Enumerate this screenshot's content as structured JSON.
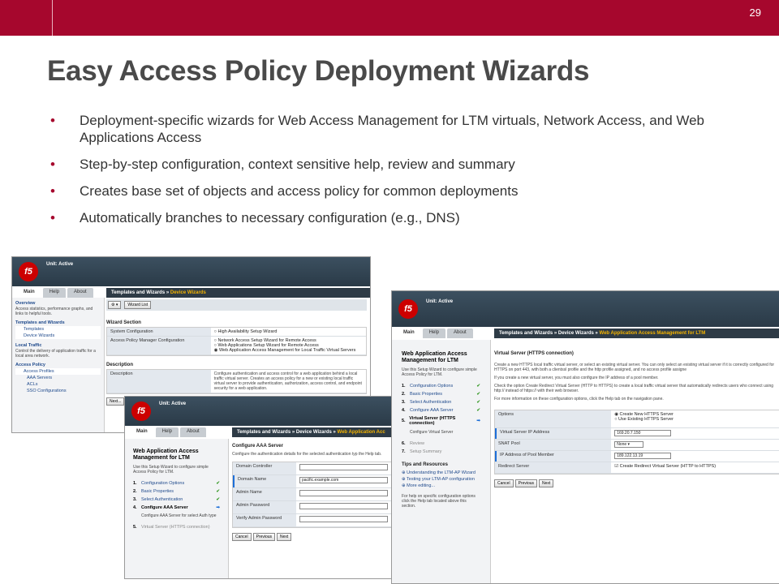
{
  "slide": {
    "page_number": "29",
    "title": "Easy Access Policy Deployment Wizards"
  },
  "bullets": [
    "Deployment-specific wizards for Web Access Management for LTM virtuals, Network Access, and Web Applications Access",
    "Step-by-step configuration, context sensitive help, review and summary",
    "Creates base set of objects and access policy for common deployments",
    "Automatically branches to necessary configuration (e.g., DNS)"
  ],
  "common": {
    "logo": "f5",
    "unit": "Unit: Active",
    "tab_main": "Main",
    "tab_help": "Help",
    "tab_about": "About"
  },
  "shot1": {
    "crumb_a": "Templates and Wizards »",
    "crumb_b": "Device Wizards",
    "toolbar_btn": "Wizard List",
    "nav": [
      {
        "title": "Overview",
        "desc": "Access statistics, performance graphs, and links to helpful tools."
      },
      {
        "title": "Templates and Wizards",
        "sub": [
          "Templates",
          "Device Wizards"
        ]
      },
      {
        "title": "Local Traffic",
        "desc": "Control the delivery of application traffic for a local area network."
      },
      {
        "title": "Access Policy",
        "sub": [
          "Access Profiles",
          "AAA Servers",
          "ACLs",
          "SSO Configurations"
        ]
      }
    ],
    "section_wizard": "Wizard Section",
    "sys_config_label": "System Configuration",
    "sys_config_opt": "High Availability Setup Wizard",
    "apm_label": "Access Policy Manager Configuration",
    "apm_opts": [
      "Network Access Setup Wizard for Remote Access",
      "Web Applications Setup Wizard for Remote Access",
      "Web Application Access Management for Local Traffic Virtual Servers"
    ],
    "section_desc": "Description",
    "desc_label": "Description",
    "desc_text": "Configure authentication and access control for a web application behind a local traffic virtual server. Creates an access policy for a new or existing local traffic virtual server to provide authentication, authorization, access control, and endpoint security for a web application.",
    "next": "Next..."
  },
  "shot2": {
    "crumb_a": "Templates and Wizards »",
    "crumb_b": "Device Wizards »",
    "crumb_c": "Web Application Acc",
    "wiz_title": "Web Application Access Management for LTM",
    "wiz_desc": "Use this Setup Wizard to configure simple Access Policy for LTM.",
    "steps": [
      {
        "n": "1.",
        "label": "Configuration Options"
      },
      {
        "n": "2.",
        "label": "Basic Properties"
      },
      {
        "n": "3.",
        "label": "Select Authentication"
      },
      {
        "n": "4.",
        "label": "Configure AAA Server"
      }
    ],
    "step_sub": "Configure AAA Server for select Auth type",
    "step5": {
      "n": "5.",
      "label": "Virtual Server (HTTPS connection)"
    },
    "heading": "Configure AAA Server",
    "heading_desc": "Configure the authentication details for the selected authentication typ the Help tab.",
    "fields": [
      {
        "label": "Domain Controller",
        "value": ""
      },
      {
        "label": "Domain Name",
        "value": "pacific.example.com"
      },
      {
        "label": "Admin Name",
        "value": ""
      },
      {
        "label": "Admin Password",
        "value": ""
      },
      {
        "label": "Verify Admin Password",
        "value": ""
      }
    ],
    "btn_cancel": "Cancel",
    "btn_prev": "Previous",
    "btn_next": "Next"
  },
  "shot3": {
    "crumb_a": "Templates and Wizards »",
    "crumb_b": "Device Wizards »",
    "crumb_c": "Web Application Access Management for LTM",
    "wiz_title": "Web Application Access Management for LTM",
    "wiz_desc": "Use this Setup Wizard to configure simple Access Policy for LTM.",
    "steps": [
      {
        "n": "1.",
        "label": "Configuration Options"
      },
      {
        "n": "2.",
        "label": "Basic Properties"
      },
      {
        "n": "3.",
        "label": "Select Authentication"
      },
      {
        "n": "4.",
        "label": "Configure AAA Server"
      }
    ],
    "step5": {
      "n": "5.",
      "label": "Virtual Server (HTTPS connection)"
    },
    "step5_sub": "Configure Virtual Server",
    "step6": {
      "n": "6.",
      "label": "Review"
    },
    "step7": {
      "n": "7.",
      "label": "Setup Summary"
    },
    "tips_title": "Tips and Resources",
    "tips": [
      "Understanding the LTM-AP Wizard",
      "Testing your LTM-AP configuration",
      "More editing..."
    ],
    "help_text": "For help on specific configuration options click the Help tab located above this section.",
    "heading": "Virtual Server (HTTPS connection)",
    "p1": "Create a new HTTPS local traffic virtual server, or select an existing virtual server. You can only select an existing virtual server if it is correctly configured for HTTPS on port 443, with both a clientssl profile and the http profile assigned, and no access profile assigne",
    "p2": "If you create a new virtual server, you must also configure the IP address of a pool member.",
    "p3": "Check the option Create Redirect Virtual Server (HTTP to HTTPS) to create a local traffic virtual server that automatically redirects users who connect using http:// instead of https:// with their web browser.",
    "p4": "For more information on these configuration options, click the Help tab on the navigation pane.",
    "options_label": "Options",
    "opt1": "Create New HTTPS Server",
    "opt2": "Use Existing HTTPS Server",
    "vip_label": "Virtual Server IP Address",
    "vip_value": "169.20.7.150",
    "snat_label": "SNAT Pool",
    "snat_value": "None",
    "pool_label": "IP Address of Pool Member",
    "pool_value": "189.122.13.19",
    "redirect_label": "Redirect Server",
    "redirect_value": "Create Redirect Virtual Server (HTTP to HTTPS)",
    "btn_cancel": "Cancel",
    "btn_prev": "Previous",
    "btn_next": "Next"
  }
}
